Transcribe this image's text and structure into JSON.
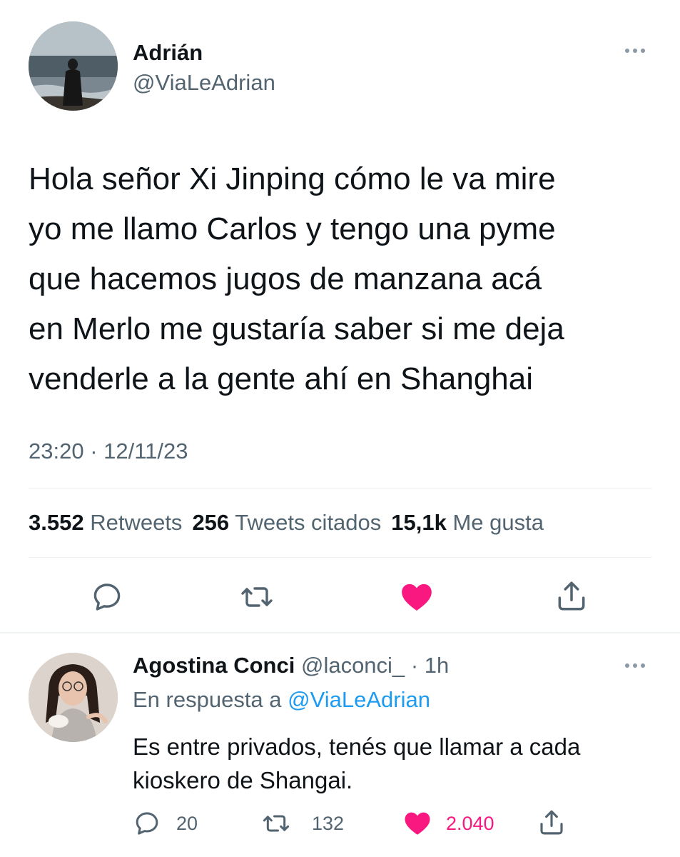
{
  "tweet": {
    "author_name": "Adrián",
    "author_handle": "@ViaLeAdrian",
    "text": "Hola señor Xi Jinping cómo le va mire\nyo me llamo Carlos y tengo una pyme\nque hacemos jugos de manzana acá\nen Merlo me gustaría saber si me deja\nvenderle a la gente ahí en Shanghai",
    "timestamp": "23:20 · 12/11/23",
    "stats": {
      "retweets_count": "3.552",
      "retweets_label": "Retweets",
      "quotes_count": "256",
      "quotes_label": "Tweets citados",
      "likes_count": "15,1k",
      "likes_label": "Me gusta"
    },
    "actions": [
      "reply-icon",
      "retweet-icon",
      "heart-icon",
      "share-icon"
    ],
    "liked": true
  },
  "reply": {
    "author_name": "Agostina Conci",
    "author_handle": "@laconci_",
    "time": "· 1h",
    "reply_prefix": "En respuesta a",
    "reply_mention": "@ViaLeAdrian",
    "text": "Es entre privados, tenés que llamar a cada\nkioskero de Shangai.",
    "counts": {
      "replies": "20",
      "retweets": "132",
      "likes": "2.040"
    },
    "liked": true
  },
  "colors": {
    "text": "#0f1419",
    "secondary": "#536471",
    "link": "#1d9bf0",
    "like": "#f91880",
    "divider": "#eff3f4"
  }
}
